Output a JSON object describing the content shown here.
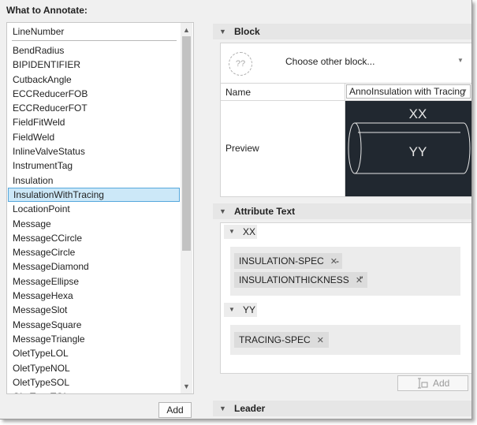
{
  "panel_title": "What to Annotate:",
  "list": {
    "header": "LineNumber",
    "items": [
      "BendRadius",
      "BIPIDENTIFIER",
      "CutbackAngle",
      "ECCReducerFOB",
      "ECCReducerFOT",
      "FieldFitWeld",
      "FieldWeld",
      "InlineValveStatus",
      "InstrumentTag",
      "Insulation",
      "InsulationWithTracing",
      "LocationPoint",
      "Message",
      "MessageCCircle",
      "MessageCircle",
      "MessageDiamond",
      "MessageEllipse",
      "MessageHexa",
      "MessageSlot",
      "MessageSquare",
      "MessageTriangle",
      "OletTypeLOL",
      "OletTypeNOL",
      "OletTypeSOL",
      "OletTypeTOL"
    ],
    "selected": "InsulationWithTracing"
  },
  "add_button_label": "Add",
  "block_section": {
    "title": "Block",
    "dropdown_icon_text": "??",
    "dropdown_text": "Choose other block...",
    "name_label": "Name",
    "name_value": "AnnoInsulation with Tracing",
    "preview_label": "Preview",
    "preview_tags": [
      "XX",
      "YY"
    ]
  },
  "attribute_section": {
    "title": "Attribute Text",
    "groups": [
      {
        "name": "XX",
        "chips": [
          "INSULATION-SPEC",
          "INSULATIONTHICKNESS"
        ],
        "separators": [
          "-",
          "\""
        ]
      },
      {
        "name": "YY",
        "chips": [
          "TRACING-SPEC"
        ],
        "separators": []
      }
    ],
    "add_label": "Add"
  },
  "leader_section": {
    "title": "Leader"
  },
  "colors": {
    "selection": "#cce8f8",
    "selection_border": "#56a8dc",
    "preview_bg": "#212830"
  }
}
